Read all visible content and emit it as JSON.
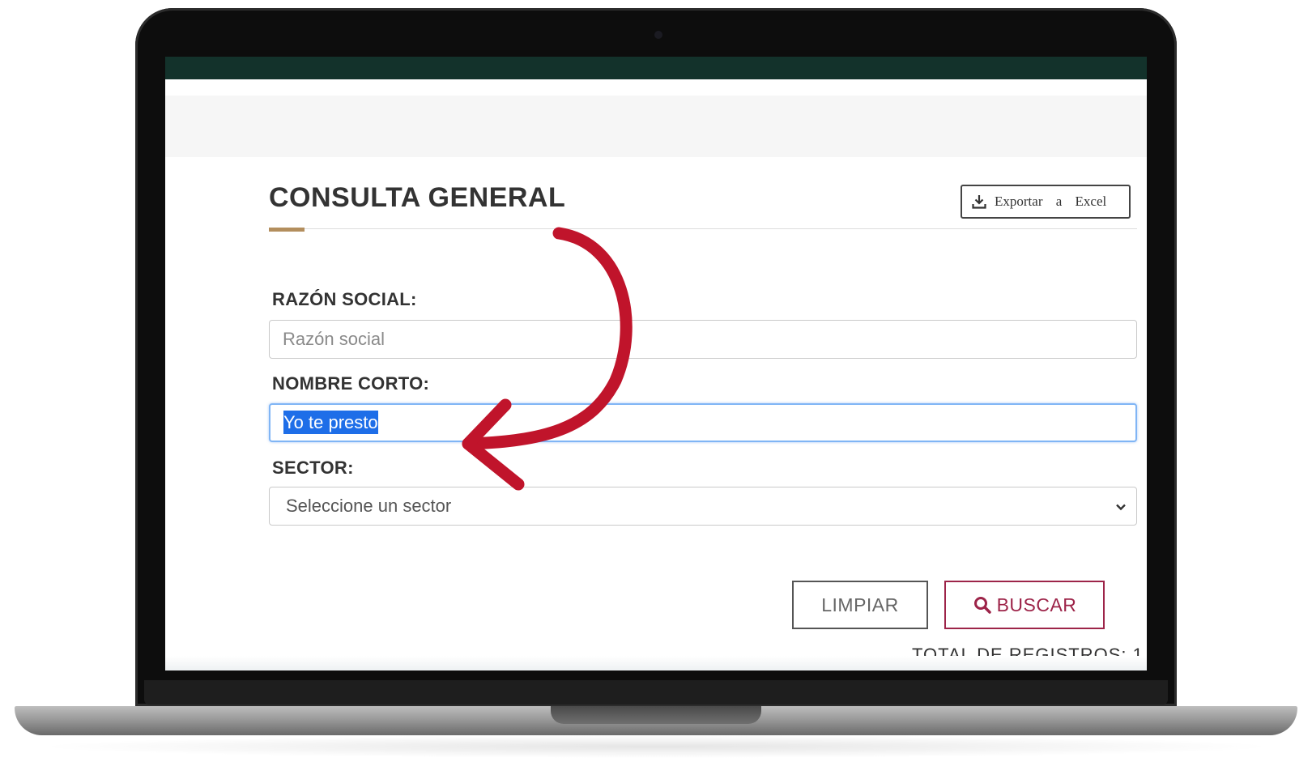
{
  "page": {
    "title": "CONSULTA GENERAL",
    "export_button": "Exportar a Excel"
  },
  "form": {
    "razon_social": {
      "label": "RAZÓN SOCIAL:",
      "placeholder": "Razón social",
      "value": ""
    },
    "nombre_corto": {
      "label": "NOMBRE CORTO:",
      "value": "Yo te presto",
      "selected": true
    },
    "sector": {
      "label": "SECTOR:",
      "selected_option": "Seleccione un sector"
    }
  },
  "actions": {
    "clear_label": "LIMPIAR",
    "search_label": "BUSCAR"
  },
  "results": {
    "total_label": "TOTAL DE REGISTROS: 1"
  },
  "colors": {
    "header_bar": "#13322b",
    "title_accent": "#b38e5d",
    "primary": "#9d2449",
    "focus": "#80b5f5",
    "selection": "#1e6ee8",
    "annotation_arrow": "#c0142b"
  },
  "icons": [
    "download-icon",
    "search-icon",
    "chevron-down-icon"
  ]
}
